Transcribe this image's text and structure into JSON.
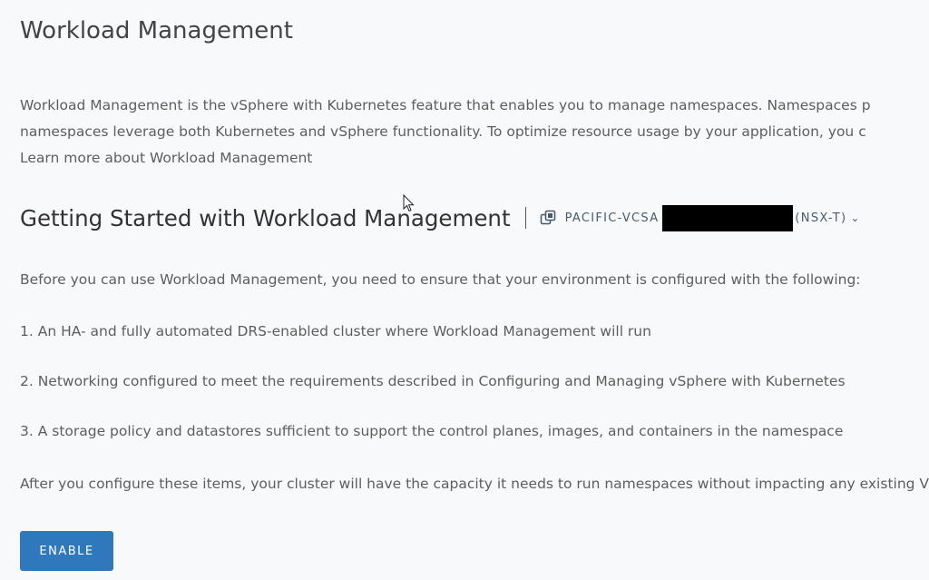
{
  "page": {
    "title": "Workload Management"
  },
  "intro": {
    "line1": "Workload Management is the vSphere with Kubernetes feature that enables you to manage namespaces. Namespaces p",
    "line2": "namespaces leverage both Kubernetes and vSphere functionality. To optimize resource usage by your application, you c",
    "learn_more": "Learn more about Workload Management"
  },
  "getting_started": {
    "title": "Getting Started with Workload Management",
    "vcenter_prefix": "PACIFIC-VCSA",
    "vcenter_suffix": "(NSX-T)",
    "chevron": "⌄",
    "icons": {
      "vcenter": "vcenter-copy-icon",
      "chevron": "chevron-down-icon"
    },
    "prerequisites_intro": "Before you can use Workload Management, you need to ensure that your environment is configured with the following:",
    "items": [
      "1. An HA- and fully automated DRS-enabled cluster where Workload Management will run",
      "2. Networking configured to meet the requirements described in Configuring and Managing vSphere with Kubernetes",
      "3. A storage policy and datastores sufficient to support the control planes, images, and containers in the namespace"
    ],
    "after_text": "After you configure these items, your cluster will have the capacity it needs to run namespaces without impacting any existing VM",
    "enable_label": "ENABLE"
  },
  "colors": {
    "background": "#f8f9fa",
    "button": "#2f78bc",
    "vcenter_text": "#4a5b70",
    "redaction": "#000000"
  }
}
